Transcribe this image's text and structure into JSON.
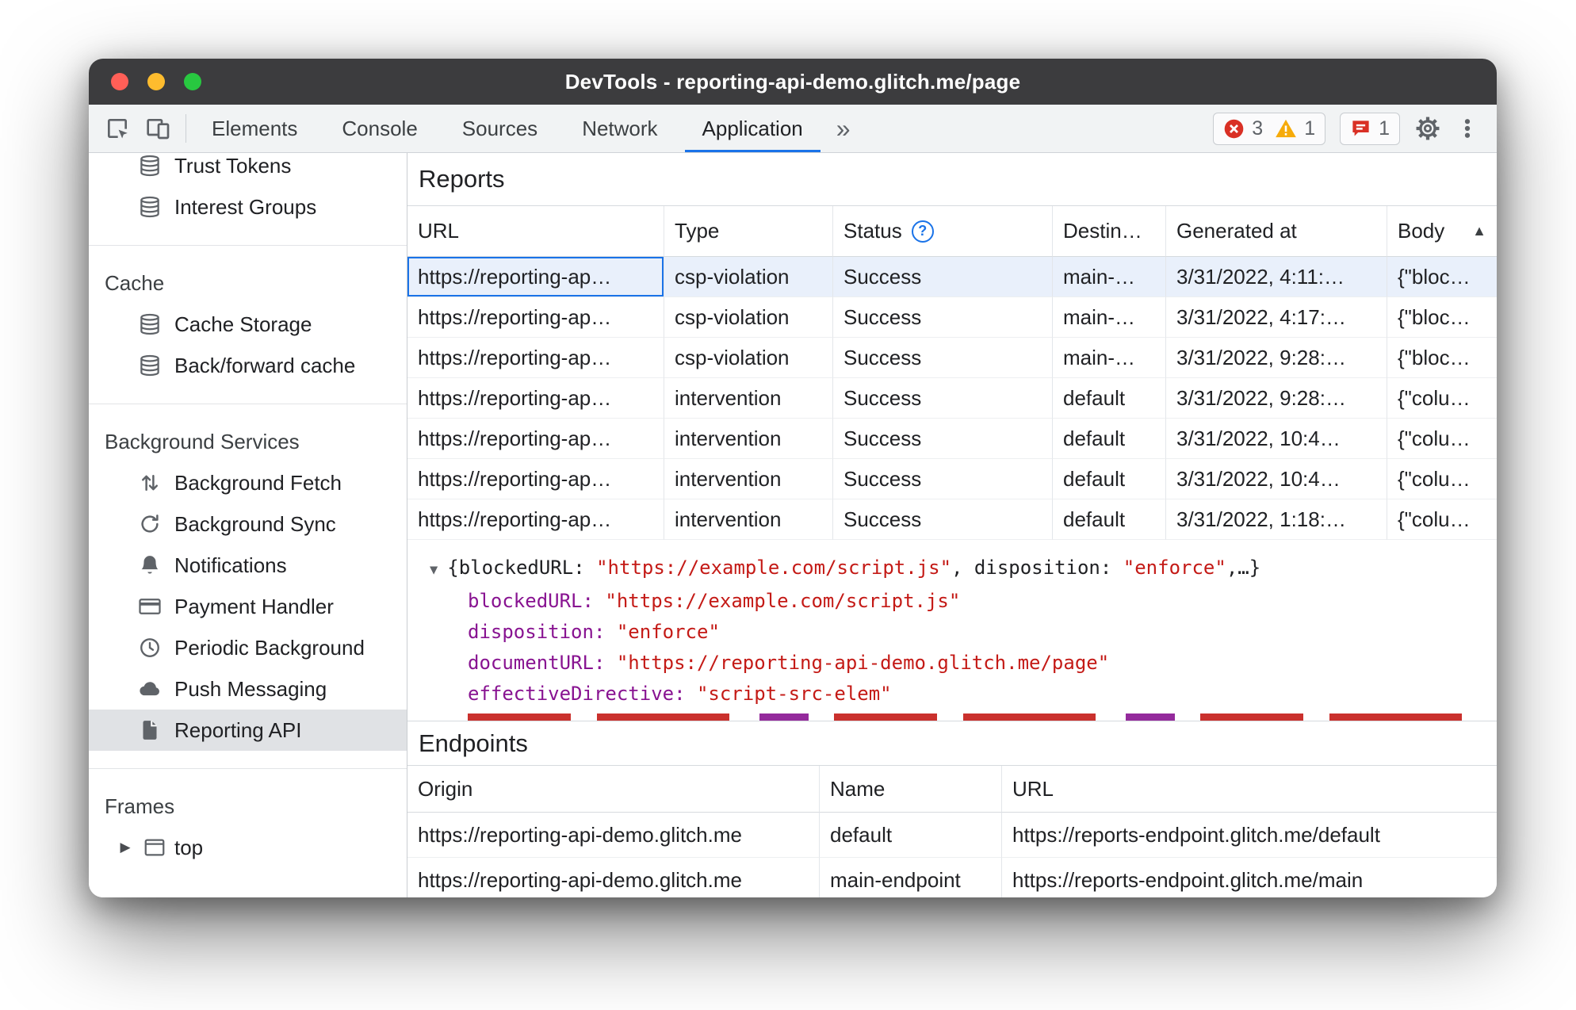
{
  "window": {
    "title": "DevTools - reporting-api-demo.glitch.me/page"
  },
  "toolbar": {
    "tabs": [
      "Elements",
      "Console",
      "Sources",
      "Network",
      "Application"
    ],
    "selected_tab": "Application",
    "more_tabs": "»",
    "error_count": "3",
    "warning_count": "1",
    "issue_count": "1"
  },
  "sidebar": {
    "sections": [
      {
        "header": "",
        "items": [
          {
            "label": "Trust Tokens",
            "icon": "database-icon"
          },
          {
            "label": "Interest Groups",
            "icon": "database-icon"
          }
        ]
      },
      {
        "header": "Cache",
        "items": [
          {
            "label": "Cache Storage",
            "icon": "database-icon"
          },
          {
            "label": "Back/forward cache",
            "icon": "database-icon"
          }
        ]
      },
      {
        "header": "Background Services",
        "items": [
          {
            "label": "Background Fetch",
            "icon": "up-down-arrows-icon"
          },
          {
            "label": "Background Sync",
            "icon": "refresh-icon"
          },
          {
            "label": "Notifications",
            "icon": "bell-icon"
          },
          {
            "label": "Payment Handler",
            "icon": "credit-card-icon"
          },
          {
            "label": "Periodic Background",
            "icon": "clock-icon"
          },
          {
            "label": "Push Messaging",
            "icon": "cloud-icon"
          },
          {
            "label": "Reporting API",
            "icon": "file-icon"
          }
        ]
      },
      {
        "header": "Frames",
        "items": [
          {
            "label": "top",
            "icon": "frame-icon"
          }
        ]
      }
    ],
    "frames_expander": "▶"
  },
  "reports": {
    "title": "Reports",
    "help": "?",
    "sort_indicator": "▲",
    "columns": {
      "url": "URL",
      "type": "Type",
      "status": "Status",
      "destination": "Destin…",
      "generated": "Generated at",
      "body": "Body"
    },
    "rows": [
      {
        "url": "https://reporting-ap…",
        "type": "csp-violation",
        "status": "Success",
        "destination": "main-…",
        "generated": "3/31/2022, 4:11:…",
        "body": "{\"bloc…"
      },
      {
        "url": "https://reporting-ap…",
        "type": "csp-violation",
        "status": "Success",
        "destination": "main-…",
        "generated": "3/31/2022, 4:17:…",
        "body": "{\"bloc…"
      },
      {
        "url": "https://reporting-ap…",
        "type": "csp-violation",
        "status": "Success",
        "destination": "main-…",
        "generated": "3/31/2022, 9:28:…",
        "body": "{\"bloc…"
      },
      {
        "url": "https://reporting-ap…",
        "type": "intervention",
        "status": "Success",
        "destination": "default",
        "generated": "3/31/2022, 9:28:…",
        "body": "{\"colu…"
      },
      {
        "url": "https://reporting-ap…",
        "type": "intervention",
        "status": "Success",
        "destination": "default",
        "generated": "3/31/2022, 10:4…",
        "body": "{\"colu…"
      },
      {
        "url": "https://reporting-ap…",
        "type": "intervention",
        "status": "Success",
        "destination": "default",
        "generated": "3/31/2022, 10:4…",
        "body": "{\"colu…"
      },
      {
        "url": "https://reporting-ap…",
        "type": "intervention",
        "status": "Success",
        "destination": "default",
        "generated": "3/31/2022, 1:18:…",
        "body": "{\"colu…"
      }
    ]
  },
  "detail": {
    "expander": "▼",
    "preview": {
      "p1": "{blockedURL: ",
      "s1": "\"https://example.com/script.js\"",
      "p2": ", disposition: ",
      "s2": "\"enforce\"",
      "p3": ",…}"
    },
    "rows": [
      {
        "key": "blockedURL: ",
        "value": "\"https://example.com/script.js\""
      },
      {
        "key": "disposition: ",
        "value": "\"enforce\""
      },
      {
        "key": "documentURL: ",
        "value": "\"https://reporting-api-demo.glitch.me/page\""
      },
      {
        "key": "effectiveDirective: ",
        "value": "\"script-src-elem\""
      }
    ]
  },
  "endpoints": {
    "title": "Endpoints",
    "columns": {
      "origin": "Origin",
      "name": "Name",
      "url": "URL"
    },
    "rows": [
      {
        "origin": "https://reporting-api-demo.glitch.me",
        "name": "default",
        "url": "https://reports-endpoint.glitch.me/default"
      },
      {
        "origin": "https://reporting-api-demo.glitch.me",
        "name": "main-endpoint",
        "url": "https://reports-endpoint.glitch.me/main"
      }
    ]
  }
}
